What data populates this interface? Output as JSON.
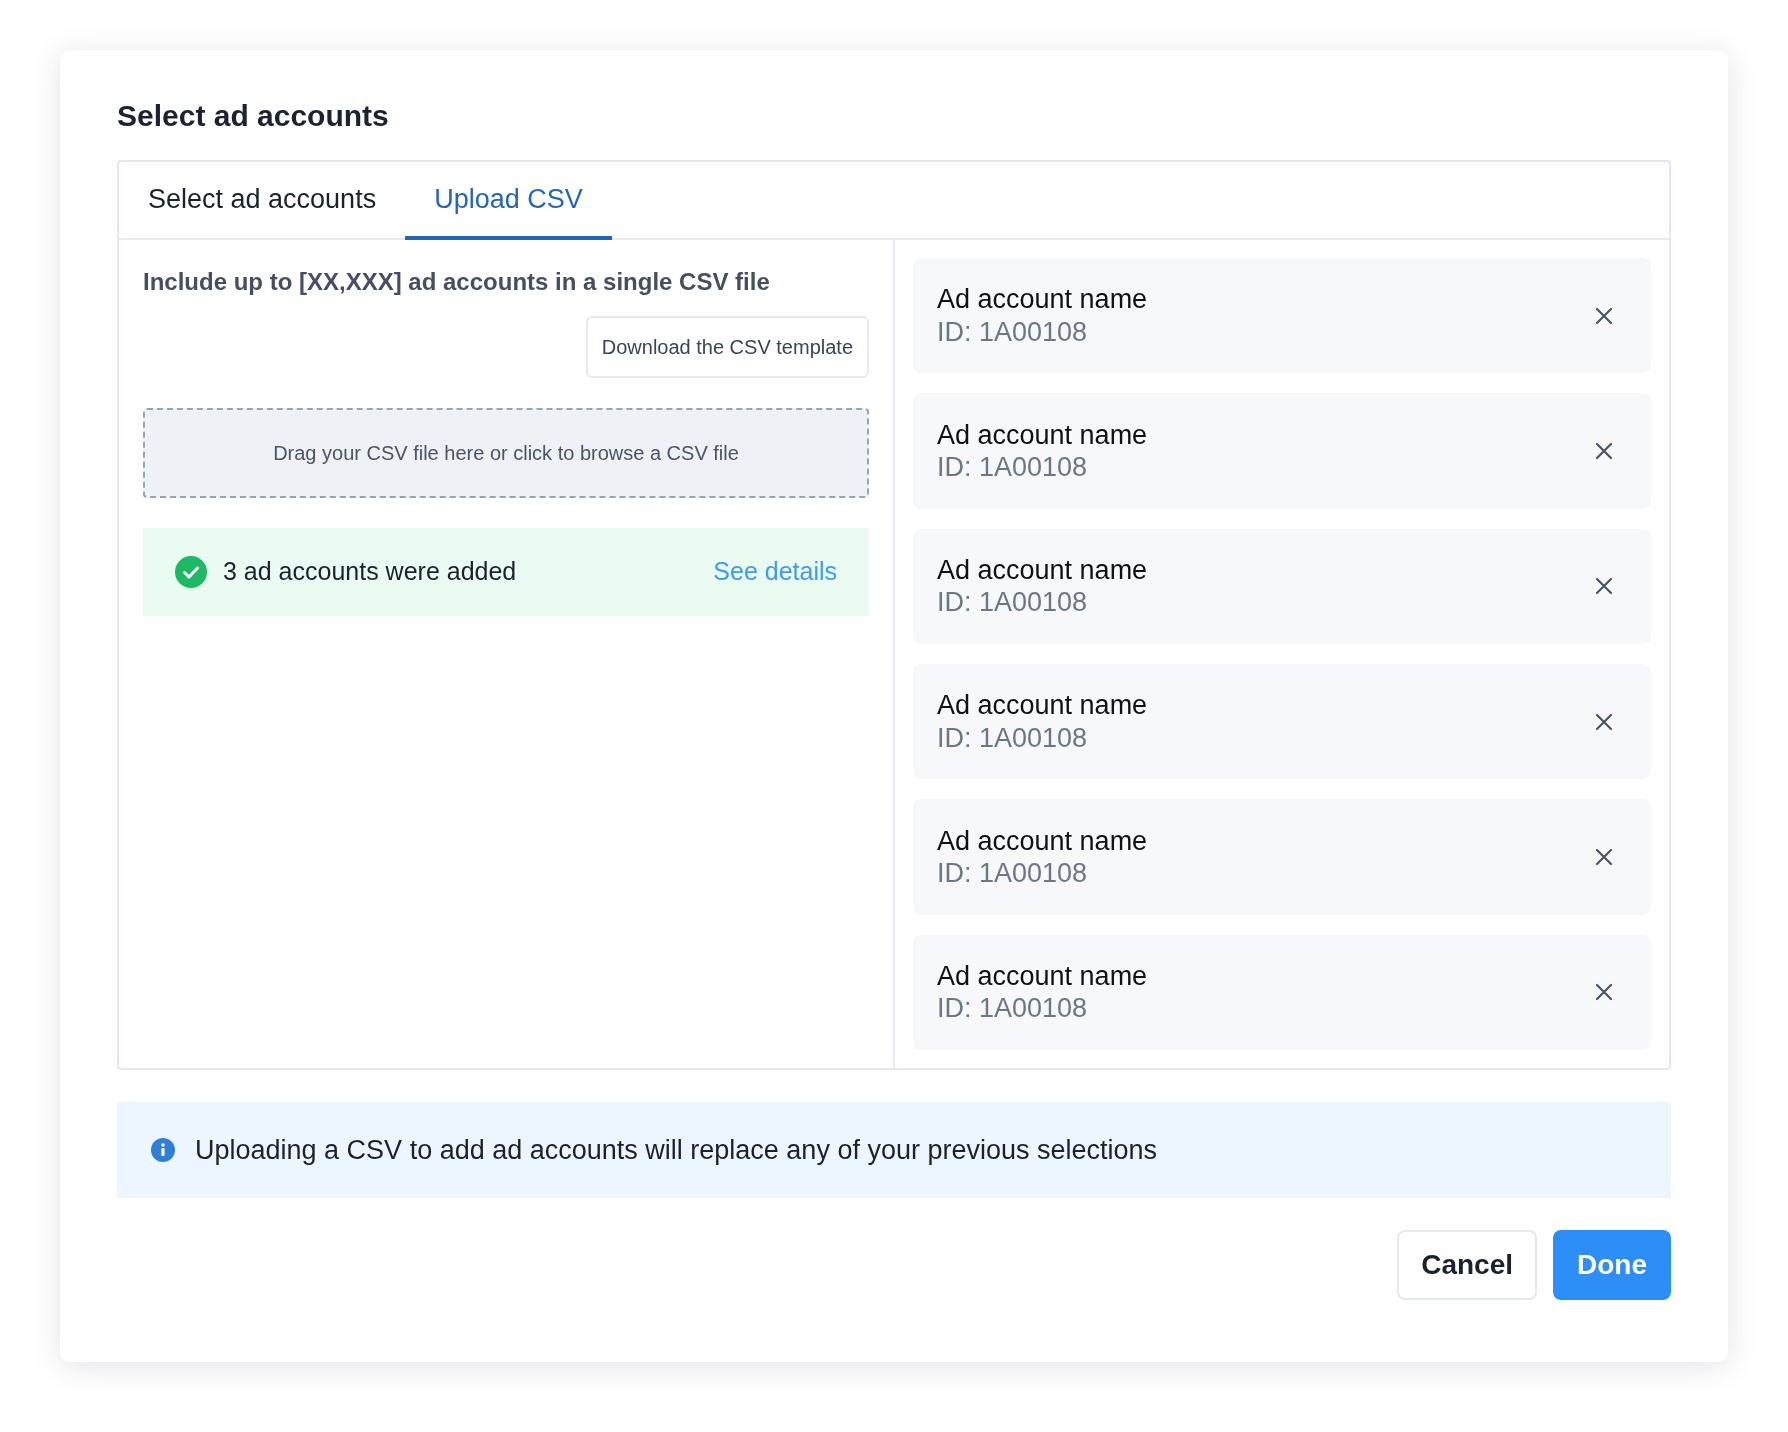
{
  "dialog": {
    "title": "Select ad accounts"
  },
  "tabs": [
    {
      "label": "Select ad accounts",
      "selected": false
    },
    {
      "label": "Upload CSV",
      "selected": true
    }
  ],
  "upload": {
    "instruction": "Include up to [XX,XXX] ad accounts in a single CSV file",
    "template_button": "Download the CSV template",
    "dropzone": "Drag your CSV file here or click to browse a CSV file",
    "result": {
      "message": "3 ad accounts were added",
      "link": "See details"
    }
  },
  "accounts": [
    {
      "name": "Ad account name",
      "id": "ID: 1A00108"
    },
    {
      "name": "Ad account name",
      "id": "ID: 1A00108"
    },
    {
      "name": "Ad account name",
      "id": "ID: 1A00108"
    },
    {
      "name": "Ad account name",
      "id": "ID: 1A00108"
    },
    {
      "name": "Ad account name",
      "id": "ID: 1A00108"
    },
    {
      "name": "Ad account name",
      "id": "ID: 1A00108"
    }
  ],
  "notice": "Uploading a CSV to add ad accounts will replace any of your previous selections",
  "buttons": {
    "cancel": "Cancel",
    "done": "Done"
  }
}
